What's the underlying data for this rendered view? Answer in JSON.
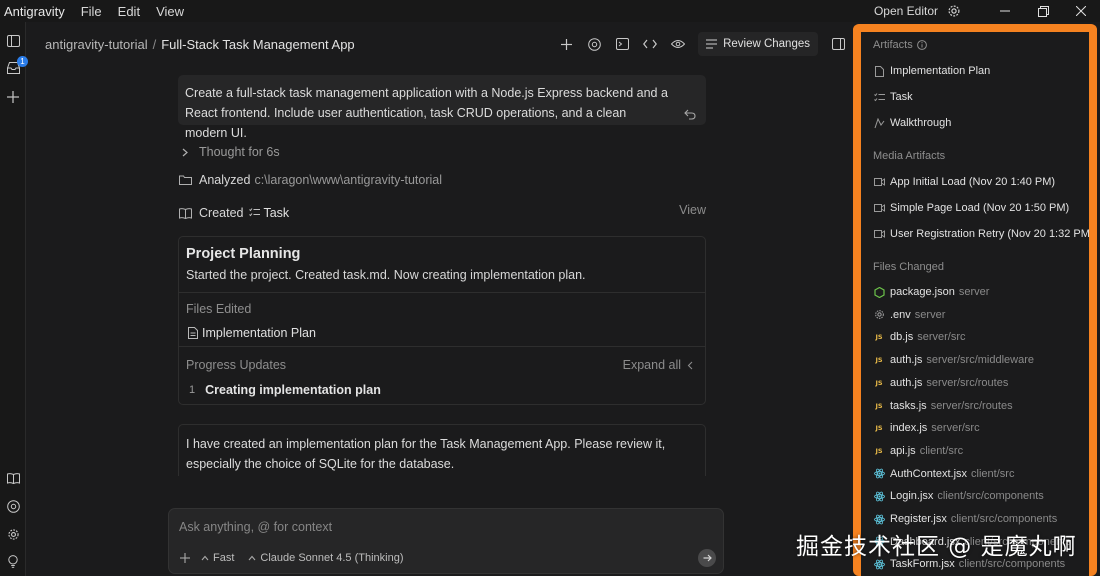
{
  "menubar": {
    "app_name": "Antigravity",
    "menus": [
      "File",
      "Edit",
      "View"
    ],
    "open_editor": "Open Editor"
  },
  "activity": {
    "inbox_badge": "1"
  },
  "header": {
    "workspace": "antigravity-tutorial",
    "separator": "/",
    "conversation": "Full-Stack Task Management App",
    "review_changes": "Review Changes"
  },
  "chat": {
    "user_prompt": "Create a full-stack task management application with a Node.js Express backend and a React frontend. Include user authentication, task CRUD operations, and a clean modern UI.",
    "thought": "Thought for 6s",
    "analyzed_label": "Analyzed",
    "analyzed_path": "c:\\laragon\\www\\antigravity-tutorial",
    "created_label": "Created",
    "created_item": "Task",
    "view_label": "View",
    "card": {
      "title": "Project Planning",
      "subtitle": "Started the project. Created task.md. Now creating implementation plan.",
      "files_edited_label": "Files Edited",
      "file": "Implementation Plan",
      "progress_label": "Progress Updates",
      "expand_all": "Expand all",
      "progress_items": [
        {
          "num": "1",
          "text": "Creating implementation plan"
        }
      ]
    },
    "assistant_reply": "I have created an implementation plan for the Task Management App. Please review it, especially the choice of SQLite for the database."
  },
  "input": {
    "placeholder": "Ask anything, @ for context",
    "mode": "Fast",
    "model": "Claude Sonnet 4.5 (Thinking)"
  },
  "panel": {
    "artifacts_label": "Artifacts",
    "artifacts": [
      "Implementation Plan",
      "Task",
      "Walkthrough"
    ],
    "media_label": "Media Artifacts",
    "media": [
      "App Initial Load (Nov 20 1:40 PM)",
      "Simple Page Load (Nov 20 1:50 PM)",
      "User Registration Retry (Nov 20 1:32 PM)"
    ],
    "files_label": "Files Changed",
    "files": [
      {
        "name": "package.json",
        "path": "server",
        "icon": "node-icon"
      },
      {
        "name": ".env",
        "path": "server",
        "icon": "gear-icon"
      },
      {
        "name": "db.js",
        "path": "server/src",
        "icon": "js-icon"
      },
      {
        "name": "auth.js",
        "path": "server/src/middleware",
        "icon": "js-icon"
      },
      {
        "name": "auth.js",
        "path": "server/src/routes",
        "icon": "js-icon"
      },
      {
        "name": "tasks.js",
        "path": "server/src/routes",
        "icon": "js-icon"
      },
      {
        "name": "index.js",
        "path": "server/src",
        "icon": "js-icon"
      },
      {
        "name": "api.js",
        "path": "client/src",
        "icon": "js-icon"
      },
      {
        "name": "AuthContext.jsx",
        "path": "client/src",
        "icon": "react-icon"
      },
      {
        "name": "Login.jsx",
        "path": "client/src/components",
        "icon": "react-icon"
      },
      {
        "name": "Register.jsx",
        "path": "client/src/components",
        "icon": "react-icon"
      },
      {
        "name": "Dashboard.jsx",
        "path": "client/src/components",
        "icon": "react-icon"
      },
      {
        "name": "TaskForm.jsx",
        "path": "client/src/components",
        "icon": "react-icon"
      }
    ]
  },
  "watermark": "掘金技术社区 @ 是魔丸啊",
  "colors": {
    "accent_orange": "#f58220",
    "badge_blue": "#2b7de9",
    "js_yellow": "#e7b948",
    "react_blue": "#5fc8e0",
    "node_green": "#6cc24a"
  }
}
